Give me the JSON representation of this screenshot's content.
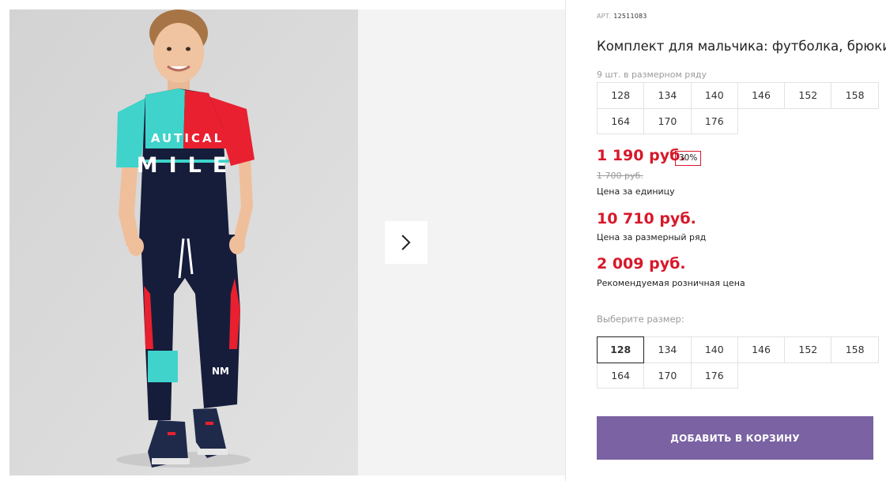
{
  "gallery": {
    "photo_alt": "boy in tee and trousers",
    "shirt_print": [
      "AUTICAL",
      "MILE"
    ],
    "next_icon": "chevron-right-icon"
  },
  "product": {
    "article_label": "АРТ.",
    "article_value": "12511083",
    "title": "Комплект для мальчика: футболка, брюки",
    "row_count": "9 шт. в размерном ряду",
    "row_sizes": [
      "128",
      "134",
      "140",
      "146",
      "152",
      "158",
      "164",
      "170",
      "176"
    ],
    "price": "1 190 руб.",
    "discount": "30%",
    "old_price": "1 700 руб.",
    "price_label": "Цена за единицу",
    "row_price": "10 710 руб.",
    "row_price_label": "Цена за размерный ряд",
    "retail_price": "2 009 руб.",
    "retail_price_label": "Рекомендуемая розничная цена",
    "choose_size_label": "Выберите размер:",
    "select_sizes": [
      "128",
      "134",
      "140",
      "146",
      "152",
      "158",
      "164",
      "170",
      "176"
    ],
    "selected_size": "128",
    "add_to_cart": "ДОБАВИТЬ В КОРЗИНУ"
  },
  "colors": {
    "accent_price": "#d7182a",
    "button_bg": "#7a62a3"
  }
}
